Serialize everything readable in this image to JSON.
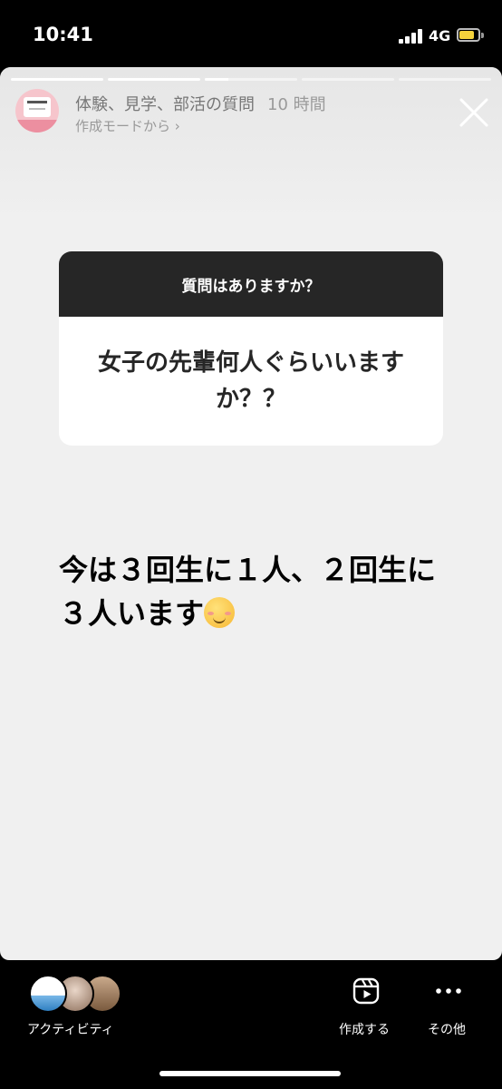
{
  "status_bar": {
    "time": "10:41",
    "network": "4G",
    "signal_bars": 4,
    "battery_level": 0.8,
    "battery_color": "#f5d33c"
  },
  "story": {
    "progress_segments": [
      1,
      1,
      0.25,
      0,
      0
    ],
    "title": "体験、見学、部活の質問",
    "time_ago": "10 時間",
    "subtitle": "作成モードから ›",
    "avatar_icon": "question-sticker-thumbnail",
    "close_icon": "close-icon"
  },
  "sticker": {
    "header": "質問はありますか？",
    "question": "女子の先輩何人ぐらいいますか？？"
  },
  "answer": {
    "text": "今は３回生に１人、２回生に３人います",
    "emoji": "smiling-face-emoji"
  },
  "bottom_bar": {
    "activity_label": "アクティビティ",
    "create_label": "作成する",
    "more_label": "その他",
    "create_icon": "reels-icon",
    "more_icon": "more-dots-icon"
  }
}
